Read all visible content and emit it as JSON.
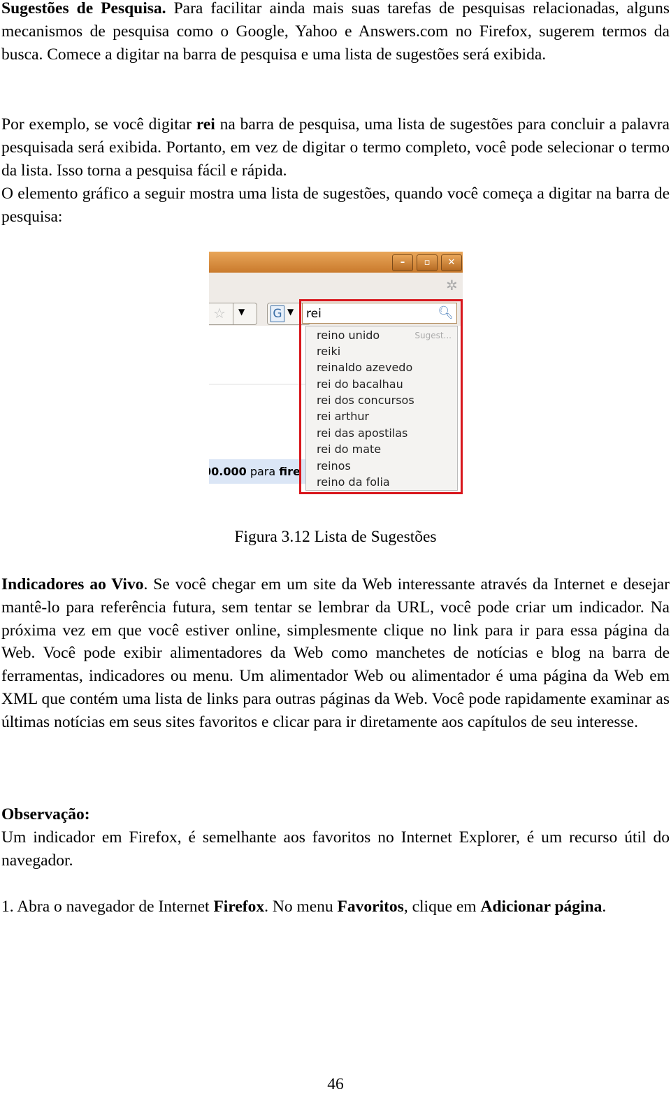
{
  "p1": {
    "bold": "Sugestões de Pesquisa.",
    "text": " Para facilitar ainda mais suas tarefas de pesquisas relacionadas, alguns mecanismos de pesquisa como o Google, Yahoo e Answers.com no Firefox, sugerem termos da busca. Comece a digitar na barra de pesquisa e uma lista de sugestões será exibida."
  },
  "p2": {
    "a": "Por exemplo, se você digitar ",
    "bold": "rei",
    "b": " na barra de pesquisa, uma lista de sugestões para concluir a palavra pesquisada será exibida. Portanto, em vez de digitar o termo completo, você pode selecionar o termo da lista. Isso torna a pesquisa fácil e rápida."
  },
  "p3": "O elemento gráfico a seguir mostra uma lista de sugestões, quando você começa a digitar na barra de pesquisa:",
  "figure": {
    "search_value": "rei",
    "engine_icon": "G",
    "suggest_label": "Sugest...",
    "suggestions": [
      "reino unido",
      "reiki",
      "reinaldo azevedo",
      "rei do bacalhau",
      "rei dos concursos",
      "rei arthur",
      "rei das apostilas",
      "rei do mate",
      "reinos",
      "reino da folia"
    ],
    "page_snippet_bold": "00.000",
    "page_snippet": " para ",
    "page_snippet_bold2": "fire",
    "highlight_color": "#d8161c",
    "caption": "Figura 3.12 Lista de Sugestões"
  },
  "p4": {
    "bold": "Indicadores ao Vivo",
    "text": ". Se você chegar em um site da Web interessante através da Internet e desejar mantê-lo para referência futura, sem tentar se lembrar da URL, você pode criar um indicador. Na próxima vez em que você estiver online, simplesmente clique no link para ir para essa página da Web. Você pode exibir alimentadores da Web como manchetes de notícias e blog na barra de ferramentas, indicadores ou menu. Um alimentador Web ou alimentador é uma página da Web em XML que contém uma lista de links para outras páginas da Web. Você pode rapidamente examinar as últimas notícias em seus sites favoritos e clicar para ir diretamente aos capítulos de seu interesse."
  },
  "note": {
    "heading": "Observação:",
    "text": "Um indicador em Firefox, é semelhante aos favoritos no Internet Explorer, é um recurso útil do navegador."
  },
  "step1": {
    "a": "1. Abra o navegador de Internet ",
    "b1": "Firefox",
    "c": ". No menu ",
    "b2": "Favoritos",
    "d": ", clique em ",
    "b3": "Adicionar página",
    "e": "."
  },
  "page_number": "46"
}
